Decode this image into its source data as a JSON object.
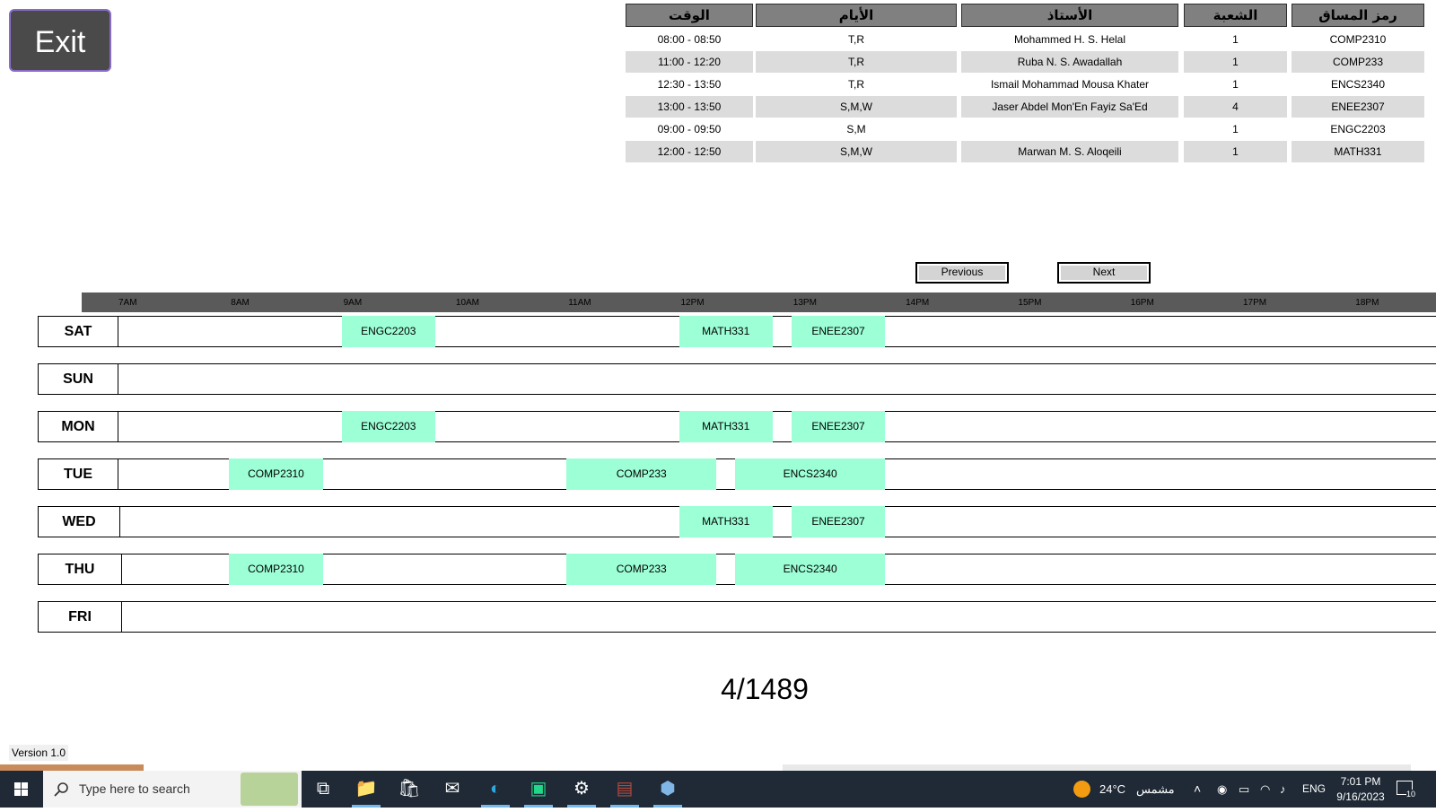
{
  "exit_label": "Exit",
  "table": {
    "headers": [
      "الوقت",
      "الأيام",
      "الأستاذ",
      "الشعبة",
      "رمز المساق"
    ],
    "rows": [
      {
        "time": "08:00 - 08:50",
        "days": "T,R",
        "instructor": "Mohammed H. S. Helal",
        "section": "1",
        "code": "COMP2310"
      },
      {
        "time": "11:00 - 12:20",
        "days": "T,R",
        "instructor": "Ruba N. S. Awadallah",
        "section": "1",
        "code": "COMP233"
      },
      {
        "time": "12:30 - 13:50",
        "days": "T,R",
        "instructor": "Ismail Mohammad Mousa Khater",
        "section": "1",
        "code": "ENCS2340"
      },
      {
        "time": "13:00 - 13:50",
        "days": "S,M,W",
        "instructor": "Jaser Abdel Mon'En Fayiz Sa'Ed",
        "section": "4",
        "code": "ENEE2307"
      },
      {
        "time": "09:00 - 09:50",
        "days": "S,M",
        "instructor": "",
        "section": "1",
        "code": "ENGC2203"
      },
      {
        "time": "12:00 - 12:50",
        "days": "S,M,W",
        "instructor": "Marwan M. S. Aloqeili",
        "section": "1",
        "code": "MATH331"
      }
    ]
  },
  "nav": {
    "previous": "Previous",
    "next": "Next"
  },
  "timeline": {
    "ticks": [
      "7AM",
      "8AM",
      "9AM",
      "10AM",
      "11AM",
      "12PM",
      "13PM",
      "14PM",
      "15PM",
      "16PM",
      "17PM",
      "18PM"
    ],
    "days": [
      {
        "label": "SAT",
        "blocks": [
          {
            "code": "ENGC2203",
            "start": "09:00",
            "end": "09:50"
          },
          {
            "code": "MATH331",
            "start": "12:00",
            "end": "12:50"
          },
          {
            "code": "ENEE2307",
            "start": "13:00",
            "end": "13:50"
          }
        ]
      },
      {
        "label": "SUN",
        "blocks": []
      },
      {
        "label": "MON",
        "blocks": [
          {
            "code": "ENGC2203",
            "start": "09:00",
            "end": "09:50"
          },
          {
            "code": "MATH331",
            "start": "12:00",
            "end": "12:50"
          },
          {
            "code": "ENEE2307",
            "start": "13:00",
            "end": "13:50"
          }
        ]
      },
      {
        "label": "TUE",
        "blocks": [
          {
            "code": "COMP2310",
            "start": "08:00",
            "end": "08:50"
          },
          {
            "code": "COMP233",
            "start": "11:00",
            "end": "12:20"
          },
          {
            "code": "ENCS2340",
            "start": "12:30",
            "end": "13:50"
          }
        ]
      },
      {
        "label": "WED",
        "blocks": [
          {
            "code": "MATH331",
            "start": "12:00",
            "end": "12:50"
          },
          {
            "code": "ENEE2307",
            "start": "13:00",
            "end": "13:50"
          }
        ]
      },
      {
        "label": "THU",
        "blocks": [
          {
            "code": "COMP2310",
            "start": "08:00",
            "end": "08:50"
          },
          {
            "code": "COMP233",
            "start": "11:00",
            "end": "12:20"
          },
          {
            "code": "ENCS2340",
            "start": "12:30",
            "end": "13:50"
          }
        ]
      },
      {
        "label": "FRI",
        "blocks": []
      }
    ]
  },
  "page_counter": "4/1489",
  "version": "Version 1.0",
  "taskbar": {
    "search_placeholder": "Type here to search",
    "icons": [
      "task-view-icon",
      "file-explorer-icon",
      "store-icon",
      "mail-icon",
      "edge-icon",
      "pycharm-icon",
      "settings-icon",
      "winrar-icon",
      "python-app-icon"
    ],
    "weather_temp": "24°C",
    "weather_desc": "مشمس",
    "language": "ENG",
    "time": "7:01 PM",
    "date": "9/16/2023",
    "notifications": "10"
  },
  "colors": {
    "block": "#9dffd6",
    "header_bg": "#808080",
    "timebar": "#5a5a5a",
    "taskbar": "#1f2a36"
  }
}
